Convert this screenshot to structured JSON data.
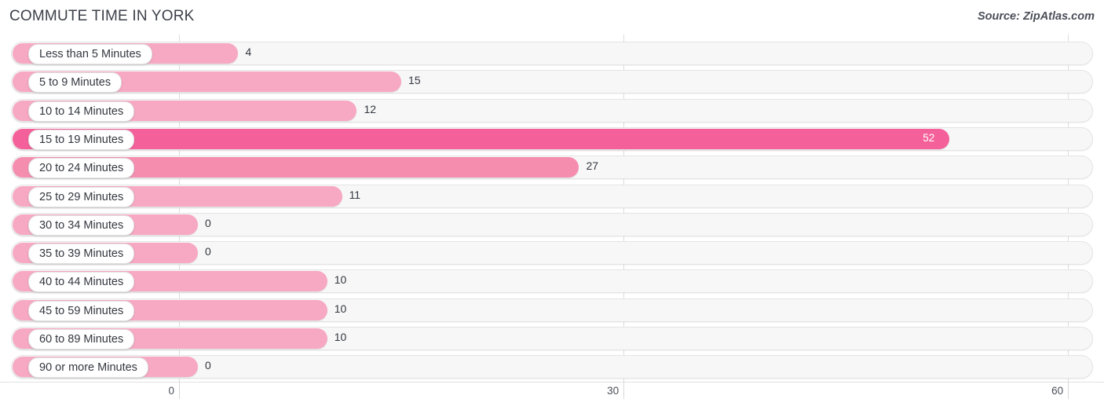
{
  "header": {
    "title": "COMMUTE TIME IN YORK",
    "source": "Source: ZipAtlas.com"
  },
  "colors": {
    "bar_light": "#F7A8C3",
    "bar_mid": "#F58DAF",
    "bar_high": "#F4609A",
    "track_fill": "#F7F7F7",
    "track_border": "#E4E4E4",
    "label_text": "#33373F",
    "value_text": "#333740",
    "value_text_inside": "#FFFFFF",
    "gridline": "#DCDCDC",
    "title_text": "#3C4049"
  },
  "chart_data": {
    "type": "bar",
    "orientation": "horizontal",
    "title": "COMMUTE TIME IN YORK",
    "xlabel": "",
    "ylabel": "",
    "xlim": [
      0,
      60
    ],
    "ticks": [
      0,
      30,
      60
    ],
    "grid": true,
    "legend": null,
    "categories": [
      "Less than 5 Minutes",
      "5 to 9 Minutes",
      "10 to 14 Minutes",
      "15 to 19 Minutes",
      "20 to 24 Minutes",
      "25 to 29 Minutes",
      "30 to 34 Minutes",
      "35 to 39 Minutes",
      "40 to 44 Minutes",
      "45 to 59 Minutes",
      "60 to 89 Minutes",
      "90 or more Minutes"
    ],
    "values": [
      4,
      15,
      12,
      52,
      27,
      11,
      0,
      0,
      10,
      10,
      10,
      0
    ],
    "value_labels": [
      "4",
      "15",
      "12",
      "52",
      "27",
      "11",
      "0",
      "0",
      "10",
      "10",
      "10",
      "0"
    ]
  },
  "axis": {
    "tick_labels": [
      "0",
      "30",
      "60"
    ]
  }
}
